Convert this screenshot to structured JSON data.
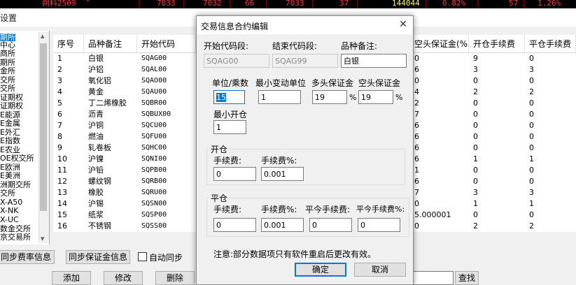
{
  "ticker": {
    "segments": [
      "朔料2509",
      "7033",
      "7032",
      "66",
      "7033",
      "37",
      "144044",
      "0.82%",
      "57",
      "1.26%"
    ],
    "flag": "*"
  },
  "background_window": {
    "title": "设置"
  },
  "exchange_list": {
    "items": [
      "期所",
      "中心",
      "商所",
      "期所",
      "金所",
      "交所",
      "交所",
      "证期权",
      "证期权",
      "E能源",
      "E金属",
      "E外汇",
      "E指数",
      "E农业",
      "OE权交所",
      "E欧洲",
      "E美洲",
      "洲期交所",
      "交所",
      "X-A50",
      "X-NK",
      "X-UC",
      "数金交所",
      "京交易所"
    ],
    "selected_index": 0
  },
  "table": {
    "columns": [
      "序号",
      "品种备注",
      "开始代码",
      "空头保证金(%)",
      "开仓手续费",
      "平仓手续费"
    ],
    "rows": [
      {
        "no": "1",
        "name": "白银",
        "code": "SQAG00",
        "short_margin": "0",
        "open_fee": "9",
        "close_fee": "0"
      },
      {
        "no": "2",
        "name": "沪铝",
        "code": "SQAL00",
        "short_margin": "6",
        "open_fee": "3",
        "close_fee": "3"
      },
      {
        "no": "3",
        "name": "氧化铝",
        "code": "SQAO00",
        "short_margin": "0",
        "open_fee": "0",
        "close_fee": "0"
      },
      {
        "no": "4",
        "name": "黄金",
        "code": "SQAU00",
        "short_margin": "4",
        "open_fee": "2",
        "close_fee": "2"
      },
      {
        "no": "5",
        "name": "丁二烯橡胶",
        "code": "SQBR00",
        "short_margin": "2",
        "open_fee": "0",
        "close_fee": "0"
      },
      {
        "no": "6",
        "name": "沥青",
        "code": "SQBUX00",
        "short_margin": "7",
        "open_fee": "0",
        "close_fee": "0"
      },
      {
        "no": "7",
        "name": "沪铜",
        "code": "SQCU00",
        "short_margin": "6",
        "open_fee": "0",
        "close_fee": "0"
      },
      {
        "no": "8",
        "name": "燃油",
        "code": "SQFU00",
        "short_margin": "6",
        "open_fee": "0",
        "close_fee": "0"
      },
      {
        "no": "9",
        "name": "轧卷板",
        "code": "SQHC00",
        "short_margin": "6",
        "open_fee": "0",
        "close_fee": "0"
      },
      {
        "no": "10",
        "name": "沪镍",
        "code": "SQNI00",
        "short_margin": "6",
        "open_fee": "1",
        "close_fee": "1"
      },
      {
        "no": "11",
        "name": "沪铅",
        "code": "SQPB00",
        "short_margin": "1",
        "open_fee": "0",
        "close_fee": "0"
      },
      {
        "no": "12",
        "name": "螺纹钢",
        "code": "SQRB00",
        "short_margin": "6",
        "open_fee": "0",
        "close_fee": "0"
      },
      {
        "no": "13",
        "name": "橡胶",
        "code": "SQRU00",
        "short_margin": "7",
        "open_fee": "3",
        "close_fee": "3"
      },
      {
        "no": "14",
        "name": "沪锡",
        "code": "SQSN00",
        "short_margin": "0",
        "open_fee": "1",
        "close_fee": "1"
      },
      {
        "no": "15",
        "name": "纸浆",
        "code": "SQSP00",
        "short_margin": "5.000001",
        "open_fee": "0",
        "close_fee": "0"
      },
      {
        "no": "16",
        "name": "不锈钢",
        "code": "SQSS00",
        "short_margin": "0",
        "open_fee": "2",
        "close_fee": "2"
      }
    ]
  },
  "bottom_bar": {
    "sync_fee_label": "同步费率信息",
    "sync_margin_label": "同步保证金信息",
    "auto_sync_label": "自动同步",
    "add_label": "添加",
    "edit_label": "修改",
    "delete_label": "删除",
    "search_label": "查找"
  },
  "dialog": {
    "title": "交易信息合约编辑",
    "start_code_label": "开始代码段:",
    "end_code_label": "结束代码段:",
    "remark_label": "品种备注:",
    "start_code_value": "SQAG00",
    "end_code_value": "SQAG99",
    "remark_value": "白银",
    "unit_label": "单位/乘数",
    "min_tick_label": "最小变动单位",
    "long_margin_label": "多头保证金",
    "short_margin_label": "空头保证金",
    "unit_value": "15",
    "min_tick_value": "1",
    "long_margin_value": "19",
    "short_margin_value": "19",
    "percent": "%",
    "min_open_label": "最小开仓",
    "min_open_value": "1",
    "open_group_label": "开仓",
    "open_fee_label": "手续费:",
    "open_fee_pct_label": "手续费%:",
    "open_fee_value": "0",
    "open_fee_pct_value": "0.001",
    "close_group_label": "平仓",
    "close_fee_label": "手续费:",
    "close_fee_pct_label": "手续费%:",
    "close_today_fee_label": "平今手续费:",
    "close_today_fee_pct_label": "平今手续费%:",
    "close_fee_value": "0",
    "close_fee_pct_value": "0.001",
    "close_today_fee_value": "0",
    "close_today_fee_pct_value": "0",
    "note": "注意:部分数据项只有软件重启后更改有效。",
    "ok_label": "确定",
    "cancel_label": "取消"
  }
}
